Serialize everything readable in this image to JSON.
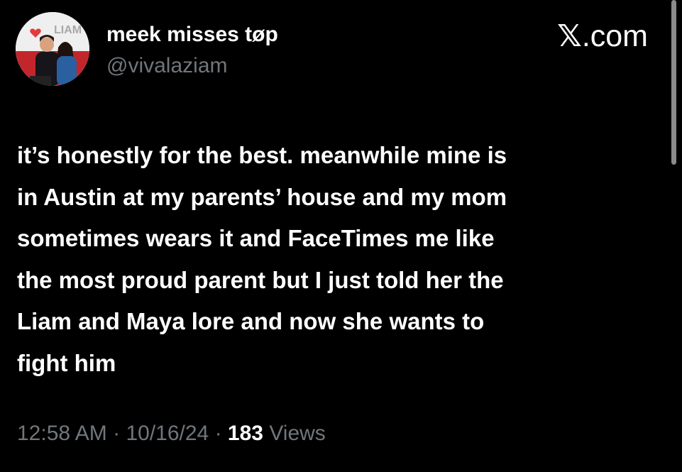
{
  "tweet": {
    "display_name": "meek misses tøp",
    "handle": "@vivalaziam",
    "source_logo": "𝕏",
    "source_suffix": ".com",
    "text_lines": [
      "it’s honestly for the best. meanwhile mine is",
      "in Austin at my parents’ house and my mom",
      "sometimes wears it and FaceTimes me like",
      "the most proud parent but I just told her the",
      "Liam and Maya lore and now she wants to",
      "fight him"
    ],
    "time": "12:58 AM",
    "separator": "·",
    "date": "10/16/24",
    "views_count": "183",
    "views_label": "Views"
  },
  "avatar_banner_text": "LIAM",
  "colors": {
    "background": "#000000",
    "text_primary": "#ffffff",
    "text_secondary": "#71767b"
  }
}
